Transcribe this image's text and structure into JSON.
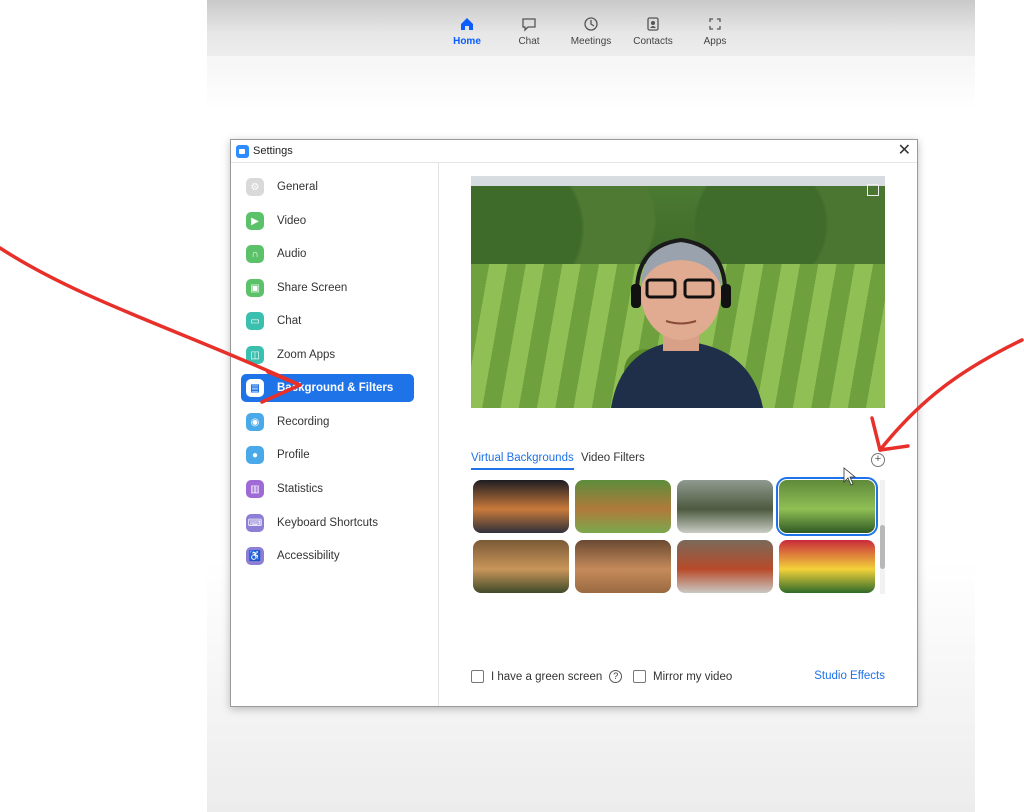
{
  "topnav": {
    "items": [
      {
        "label": "Home",
        "icon": "home-icon",
        "active": true
      },
      {
        "label": "Chat",
        "icon": "chat-bubble-icon",
        "active": false
      },
      {
        "label": "Meetings",
        "icon": "clock-icon",
        "active": false
      },
      {
        "label": "Contacts",
        "icon": "contacts-icon",
        "active": false
      },
      {
        "label": "Apps",
        "icon": "apps-icon",
        "active": false
      }
    ]
  },
  "window": {
    "title": "Settings",
    "close_label": "✕"
  },
  "sidebar": {
    "items": [
      {
        "label": "General",
        "icon": "gear-icon",
        "color": "#d9d9d9"
      },
      {
        "label": "Video",
        "icon": "video-camera-icon",
        "color": "#5cc26a"
      },
      {
        "label": "Audio",
        "icon": "headphones-icon",
        "color": "#5cc26a"
      },
      {
        "label": "Share Screen",
        "icon": "share-screen-icon",
        "color": "#5cc26a"
      },
      {
        "label": "Chat",
        "icon": "chat-icon",
        "color": "#3bbfae"
      },
      {
        "label": "Zoom Apps",
        "icon": "apps-icon",
        "color": "#3bbfae"
      },
      {
        "label": "Background & Filters",
        "icon": "person-background-icon",
        "color": "#1e73e8",
        "active": true
      },
      {
        "label": "Recording",
        "icon": "record-icon",
        "color": "#49a9e9"
      },
      {
        "label": "Profile",
        "icon": "profile-icon",
        "color": "#49a9e9"
      },
      {
        "label": "Statistics",
        "icon": "statistics-icon",
        "color": "#a06ad6"
      },
      {
        "label": "Keyboard Shortcuts",
        "icon": "keyboard-icon",
        "color": "#8d7fd6"
      },
      {
        "label": "Accessibility",
        "icon": "accessibility-icon",
        "color": "#8d7fd6"
      }
    ]
  },
  "tabs": [
    {
      "label": "Virtual Backgrounds",
      "active": true
    },
    {
      "label": "Video Filters",
      "active": false
    }
  ],
  "add_button": "+",
  "thumbnails": [
    {
      "name": "sunset-sea",
      "colors": [
        "#1d1d22",
        "#c97a3a",
        "#30303a"
      ]
    },
    {
      "name": "dog-on-grass",
      "colors": [
        "#5d8d3c",
        "#b07a3b",
        "#7aa84d"
      ]
    },
    {
      "name": "village-houses",
      "colors": [
        "#8f9a8f",
        "#4d5a3f",
        "#c9ccc4"
      ]
    },
    {
      "name": "striped-lawn",
      "colors": [
        "#5f8a3a",
        "#8fbf55",
        "#2f5a22"
      ],
      "selected": true
    },
    {
      "name": "dog-autumn",
      "colors": [
        "#7a5a36",
        "#c9955a",
        "#3f4a2a"
      ]
    },
    {
      "name": "dogs-closeup",
      "colors": [
        "#6a4a32",
        "#c58a5a",
        "#9a6a42"
      ]
    },
    {
      "name": "train-station",
      "colors": [
        "#7a6a5a",
        "#b84a2a",
        "#c9c9c4"
      ]
    },
    {
      "name": "flowers",
      "colors": [
        "#c92a3a",
        "#f2d23a",
        "#2f6a2a"
      ]
    }
  ],
  "bottom": {
    "green_screen_label": "I have a green screen",
    "help_label": "?",
    "mirror_label": "Mirror my video",
    "studio_effects_label": "Studio Effects"
  }
}
